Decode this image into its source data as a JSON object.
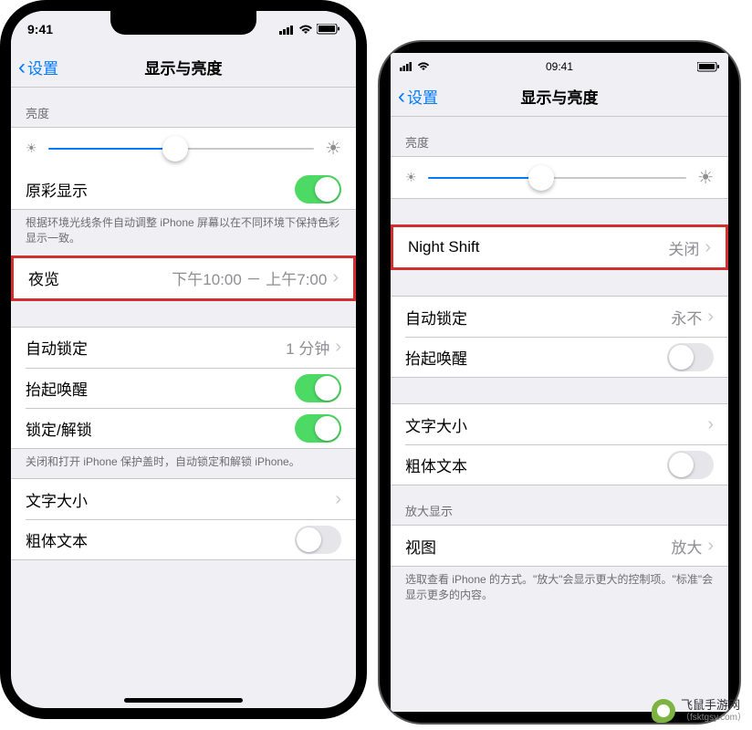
{
  "leftPhone": {
    "statusTime": "9:41",
    "navBack": "设置",
    "navTitle": "显示与亮度",
    "brightnessHeader": "亮度",
    "sliderPercent": 48,
    "trueTone": {
      "label": "原彩显示",
      "on": true
    },
    "trueToneFooter": "根据环境光线条件自动调整 iPhone 屏幕以在不同环境下保持色彩显示一致。",
    "nightShift": {
      "label": "夜览",
      "value": "下午10:00 － 上午7:00"
    },
    "autoLock": {
      "label": "自动锁定",
      "value": "1 分钟"
    },
    "raiseToWake": {
      "label": "抬起唤醒",
      "on": true
    },
    "lockUnlock": {
      "label": "锁定/解锁",
      "on": true
    },
    "lockUnlockFooter": "关闭和打开 iPhone 保护盖时，自动锁定和解锁 iPhone。",
    "textSize": {
      "label": "文字大小"
    },
    "boldText": {
      "label": "粗体文本",
      "on": false
    }
  },
  "rightPhone": {
    "statusTime": "09:41",
    "navBack": "设置",
    "navTitle": "显示与亮度",
    "brightnessHeader": "亮度",
    "sliderPercent": 44,
    "nightShift": {
      "label": "Night Shift",
      "value": "关闭"
    },
    "autoLock": {
      "label": "自动锁定",
      "value": "永不"
    },
    "raiseToWake": {
      "label": "抬起唤醒",
      "on": false
    },
    "textSize": {
      "label": "文字大小"
    },
    "boldText": {
      "label": "粗体文本",
      "on": false
    },
    "zoomHeader": "放大显示",
    "view": {
      "label": "视图",
      "value": "放大"
    },
    "viewFooter": "选取查看 iPhone 的方式。\"放大\"会显示更大的控制项。\"标准\"会显示更多的内容。"
  },
  "watermark": {
    "name": "飞鼠手游网",
    "url": "（fsktgsy.com）"
  }
}
